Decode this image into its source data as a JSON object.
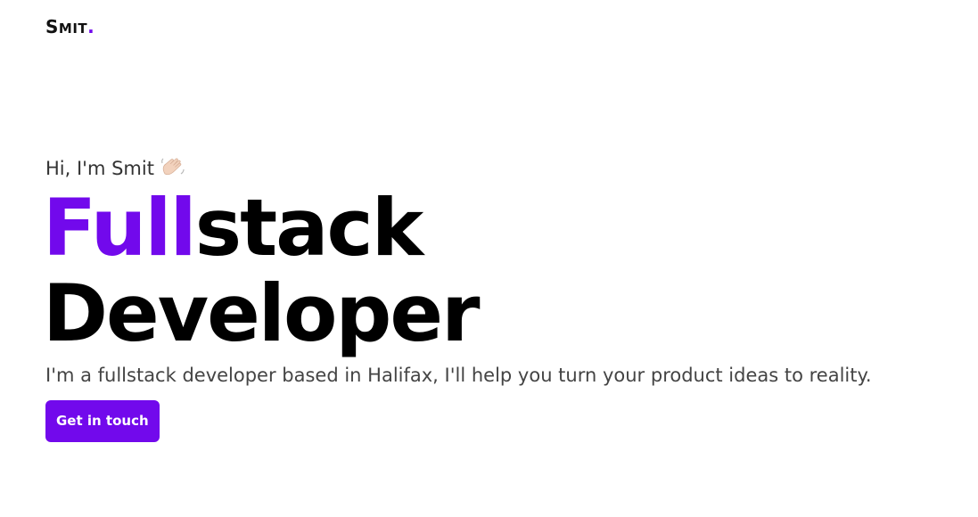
{
  "header": {
    "logo_first": "S",
    "logo_rest": "MIT",
    "logo_dot": "."
  },
  "hero": {
    "greeting": "Hi, I'm Smit",
    "greeting_icon": "waving-hand-icon",
    "headline_accent": "Full",
    "headline_rest": "stack",
    "headline_line2": "Developer",
    "subtitle": "I'm a fullstack developer based in Halifax, I'll help you turn your product ideas to reality.",
    "cta_label": "Get in touch"
  },
  "colors": {
    "accent": "#7209ec",
    "text": "#000000",
    "muted": "#444444",
    "background": "#ffffff"
  }
}
